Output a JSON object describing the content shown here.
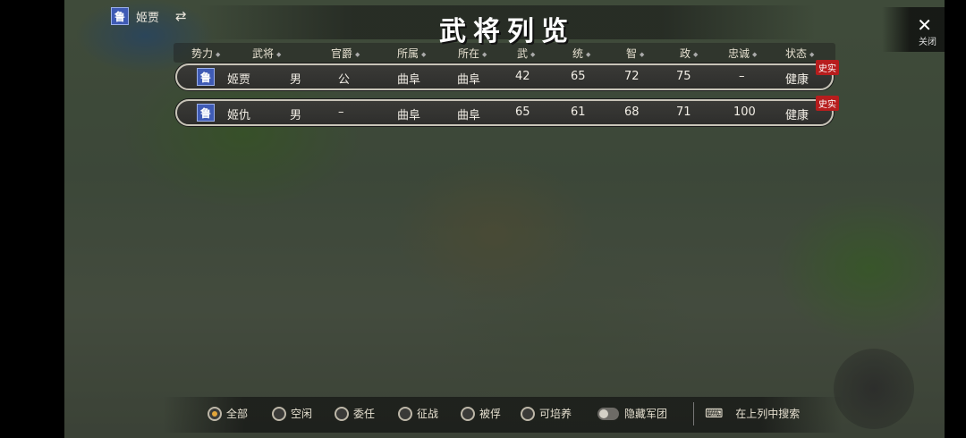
{
  "top_left": {
    "faction_seal": "鲁",
    "name": "姬贾",
    "swap_icon": "⇄"
  },
  "title": "武将列览",
  "close": {
    "icon": "✕",
    "label": "关闭"
  },
  "columns": [
    "势力",
    "武将",
    "官爵",
    "所属",
    "所在",
    "武",
    "统",
    "智",
    "政",
    "忠诚",
    "状态"
  ],
  "rows": [
    {
      "seal": "鲁",
      "name": "姬贾",
      "gender": "男",
      "rank": "公",
      "belong": "曲阜",
      "location": "曲阜",
      "war": "42",
      "lead": "65",
      "intel": "72",
      "pol": "75",
      "loyalty": "–",
      "status": "健康",
      "tag": "史实"
    },
    {
      "seal": "鲁",
      "name": "姬仇",
      "gender": "男",
      "rank": "–",
      "belong": "曲阜",
      "location": "曲阜",
      "war": "65",
      "lead": "61",
      "intel": "68",
      "pol": "71",
      "loyalty": "100",
      "status": "健康",
      "tag": "史实"
    }
  ],
  "filters": [
    {
      "label": "全部",
      "selected": true
    },
    {
      "label": "空闲",
      "selected": false
    },
    {
      "label": "委任",
      "selected": false
    },
    {
      "label": "征战",
      "selected": false
    },
    {
      "label": "被俘",
      "selected": false
    },
    {
      "label": "可培养",
      "selected": false
    }
  ],
  "hide_army_toggle": {
    "label": "隐藏军团",
    "on": false
  },
  "search": {
    "icon": "keyboard-icon",
    "label": "在上列中搜索"
  },
  "colors": {
    "seal": "#3f5bb5",
    "tag": "#b71d1d",
    "radio_selected": "#e2a53a"
  }
}
